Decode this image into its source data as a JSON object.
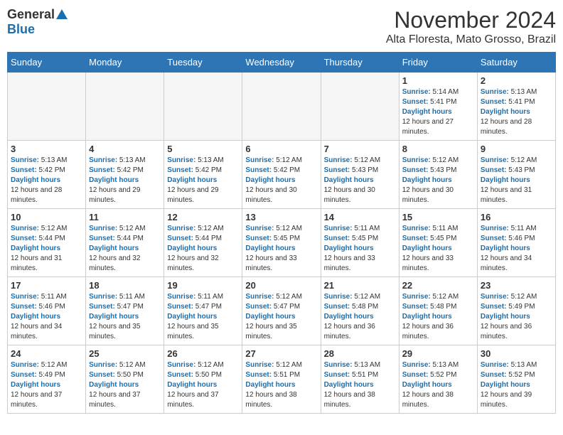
{
  "header": {
    "logo_general": "General",
    "logo_blue": "Blue",
    "month_title": "November 2024",
    "location": "Alta Floresta, Mato Grosso, Brazil"
  },
  "days_of_week": [
    "Sunday",
    "Monday",
    "Tuesday",
    "Wednesday",
    "Thursday",
    "Friday",
    "Saturday"
  ],
  "weeks": [
    [
      {
        "day": "",
        "empty": true
      },
      {
        "day": "",
        "empty": true
      },
      {
        "day": "",
        "empty": true
      },
      {
        "day": "",
        "empty": true
      },
      {
        "day": "",
        "empty": true
      },
      {
        "day": "1",
        "sunrise": "5:14 AM",
        "sunset": "5:41 PM",
        "daylight": "12 hours and 27 minutes."
      },
      {
        "day": "2",
        "sunrise": "5:13 AM",
        "sunset": "5:41 PM",
        "daylight": "12 hours and 28 minutes."
      }
    ],
    [
      {
        "day": "3",
        "sunrise": "5:13 AM",
        "sunset": "5:42 PM",
        "daylight": "12 hours and 28 minutes."
      },
      {
        "day": "4",
        "sunrise": "5:13 AM",
        "sunset": "5:42 PM",
        "daylight": "12 hours and 29 minutes."
      },
      {
        "day": "5",
        "sunrise": "5:13 AM",
        "sunset": "5:42 PM",
        "daylight": "12 hours and 29 minutes."
      },
      {
        "day": "6",
        "sunrise": "5:12 AM",
        "sunset": "5:42 PM",
        "daylight": "12 hours and 30 minutes."
      },
      {
        "day": "7",
        "sunrise": "5:12 AM",
        "sunset": "5:43 PM",
        "daylight": "12 hours and 30 minutes."
      },
      {
        "day": "8",
        "sunrise": "5:12 AM",
        "sunset": "5:43 PM",
        "daylight": "12 hours and 30 minutes."
      },
      {
        "day": "9",
        "sunrise": "5:12 AM",
        "sunset": "5:43 PM",
        "daylight": "12 hours and 31 minutes."
      }
    ],
    [
      {
        "day": "10",
        "sunrise": "5:12 AM",
        "sunset": "5:44 PM",
        "daylight": "12 hours and 31 minutes."
      },
      {
        "day": "11",
        "sunrise": "5:12 AM",
        "sunset": "5:44 PM",
        "daylight": "12 hours and 32 minutes."
      },
      {
        "day": "12",
        "sunrise": "5:12 AM",
        "sunset": "5:44 PM",
        "daylight": "12 hours and 32 minutes."
      },
      {
        "day": "13",
        "sunrise": "5:12 AM",
        "sunset": "5:45 PM",
        "daylight": "12 hours and 33 minutes."
      },
      {
        "day": "14",
        "sunrise": "5:11 AM",
        "sunset": "5:45 PM",
        "daylight": "12 hours and 33 minutes."
      },
      {
        "day": "15",
        "sunrise": "5:11 AM",
        "sunset": "5:45 PM",
        "daylight": "12 hours and 33 minutes."
      },
      {
        "day": "16",
        "sunrise": "5:11 AM",
        "sunset": "5:46 PM",
        "daylight": "12 hours and 34 minutes."
      }
    ],
    [
      {
        "day": "17",
        "sunrise": "5:11 AM",
        "sunset": "5:46 PM",
        "daylight": "12 hours and 34 minutes."
      },
      {
        "day": "18",
        "sunrise": "5:11 AM",
        "sunset": "5:47 PM",
        "daylight": "12 hours and 35 minutes."
      },
      {
        "day": "19",
        "sunrise": "5:11 AM",
        "sunset": "5:47 PM",
        "daylight": "12 hours and 35 minutes."
      },
      {
        "day": "20",
        "sunrise": "5:12 AM",
        "sunset": "5:47 PM",
        "daylight": "12 hours and 35 minutes."
      },
      {
        "day": "21",
        "sunrise": "5:12 AM",
        "sunset": "5:48 PM",
        "daylight": "12 hours and 36 minutes."
      },
      {
        "day": "22",
        "sunrise": "5:12 AM",
        "sunset": "5:48 PM",
        "daylight": "12 hours and 36 minutes."
      },
      {
        "day": "23",
        "sunrise": "5:12 AM",
        "sunset": "5:49 PM",
        "daylight": "12 hours and 36 minutes."
      }
    ],
    [
      {
        "day": "24",
        "sunrise": "5:12 AM",
        "sunset": "5:49 PM",
        "daylight": "12 hours and 37 minutes."
      },
      {
        "day": "25",
        "sunrise": "5:12 AM",
        "sunset": "5:50 PM",
        "daylight": "12 hours and 37 minutes."
      },
      {
        "day": "26",
        "sunrise": "5:12 AM",
        "sunset": "5:50 PM",
        "daylight": "12 hours and 37 minutes."
      },
      {
        "day": "27",
        "sunrise": "5:12 AM",
        "sunset": "5:51 PM",
        "daylight": "12 hours and 38 minutes."
      },
      {
        "day": "28",
        "sunrise": "5:13 AM",
        "sunset": "5:51 PM",
        "daylight": "12 hours and 38 minutes."
      },
      {
        "day": "29",
        "sunrise": "5:13 AM",
        "sunset": "5:52 PM",
        "daylight": "12 hours and 38 minutes."
      },
      {
        "day": "30",
        "sunrise": "5:13 AM",
        "sunset": "5:52 PM",
        "daylight": "12 hours and 39 minutes."
      }
    ]
  ],
  "labels": {
    "sunrise": "Sunrise:",
    "sunset": "Sunset:",
    "daylight": "Daylight hours"
  }
}
